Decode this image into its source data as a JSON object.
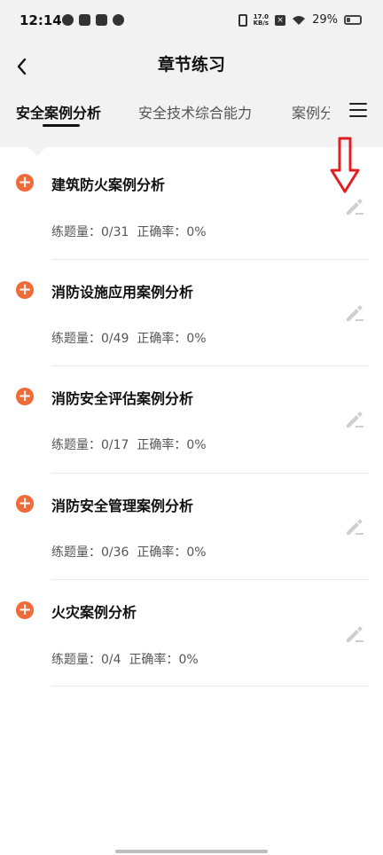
{
  "status": {
    "time": "12:14",
    "speed_top": "17.0",
    "speed_bottom": "KB/s",
    "battery": "29%",
    "battery_level": 0.29
  },
  "header": {
    "title": "章节练习",
    "back_icon": "chevron-left-icon"
  },
  "tabs": [
    {
      "label": "安全案例分析",
      "active": true
    },
    {
      "label": "安全技术综合能力",
      "active": false
    },
    {
      "label": "案例分",
      "active": false
    }
  ],
  "menu_icon": "hamburger-menu-icon",
  "chapters": [
    {
      "title": "建筑防火案例分析",
      "count_label": "练题量：",
      "count": "0/31",
      "accuracy_label": "正确率：",
      "accuracy": "0%"
    },
    {
      "title": "消防设施应用案例分析",
      "count_label": "练题量：",
      "count": "0/49",
      "accuracy_label": "正确率：",
      "accuracy": "0%"
    },
    {
      "title": "消防安全评估案例分析",
      "count_label": "练题量：",
      "count": "0/17",
      "accuracy_label": "正确率：",
      "accuracy": "0%"
    },
    {
      "title": "消防安全管理案例分析",
      "count_label": "练题量：",
      "count": "0/36",
      "accuracy_label": "正确率：",
      "accuracy": "0%"
    },
    {
      "title": "火灾案例分析",
      "count_label": "练题量：",
      "count": "0/4",
      "accuracy_label": "正确率：",
      "accuracy": "0%"
    }
  ],
  "colors": {
    "accent": "#f06b37",
    "annotation": "#e02020",
    "header_bg": "#f2f2f2"
  }
}
